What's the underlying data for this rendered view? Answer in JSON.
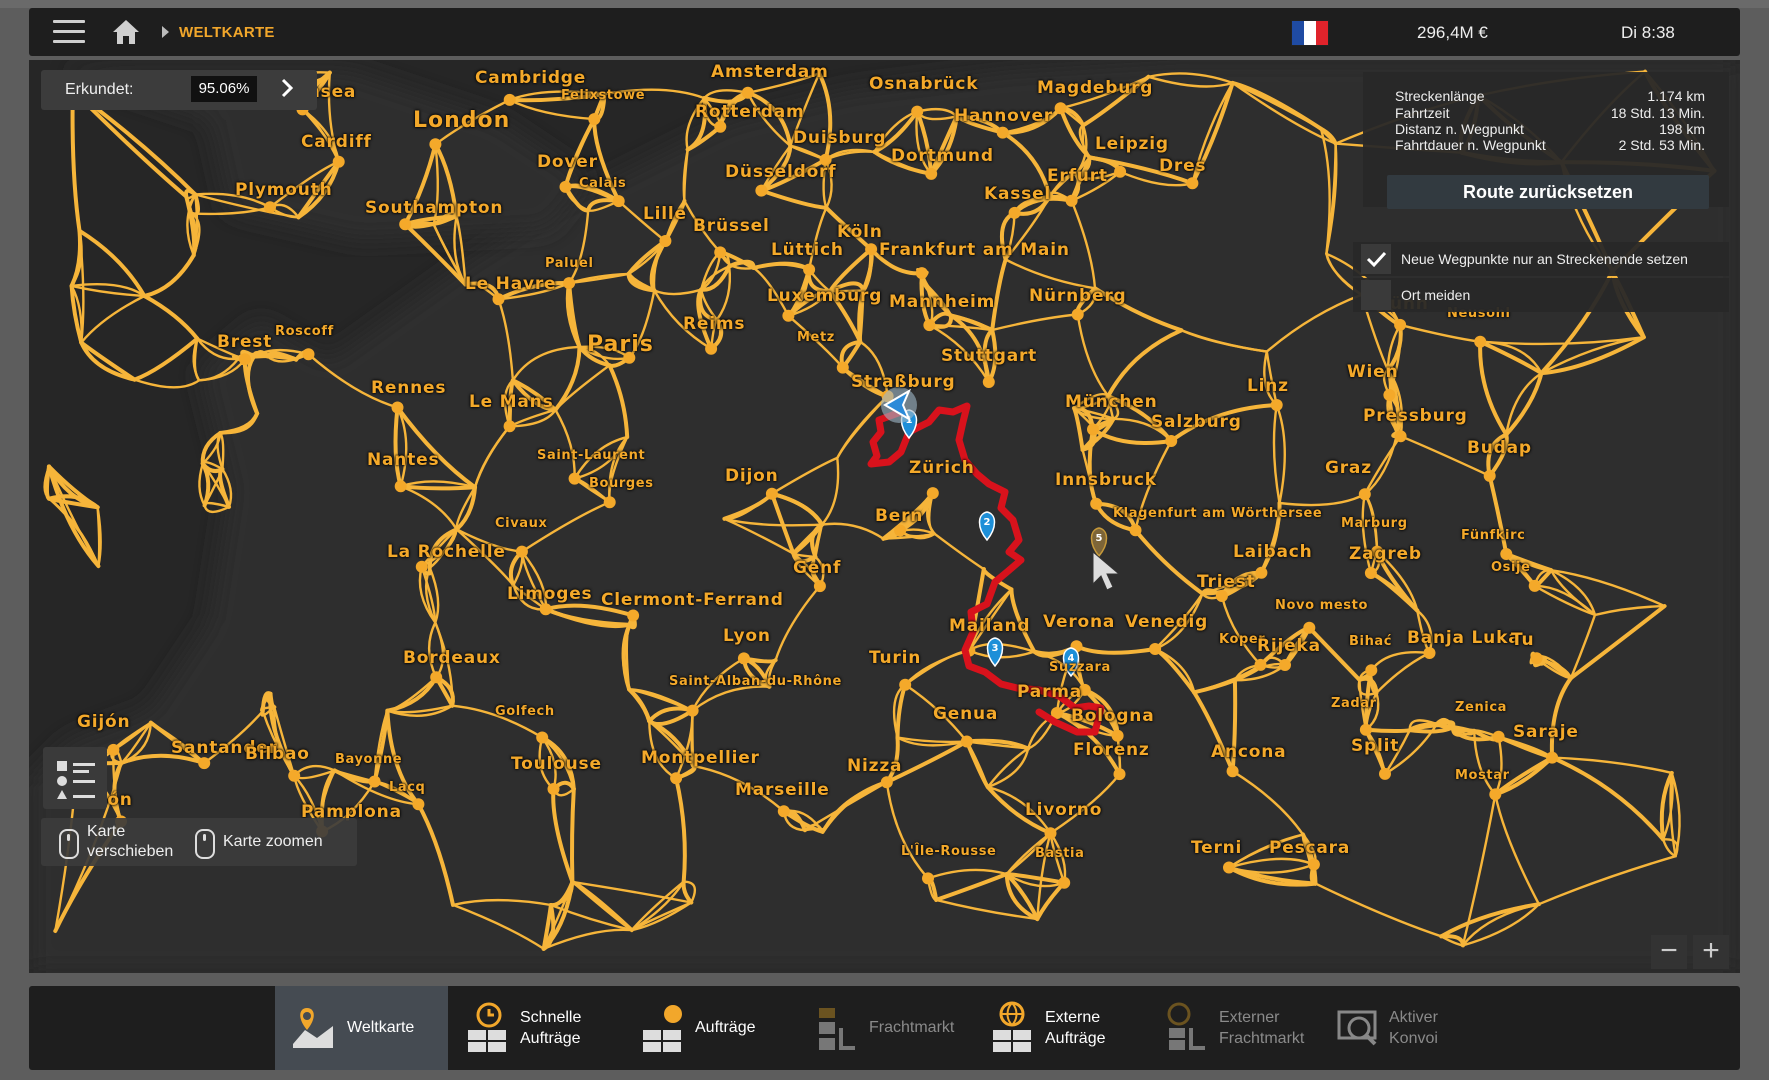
{
  "topbar": {
    "breadcrumb": "WELTKARTE",
    "money": "296,4M €",
    "time": "Di 8:38",
    "flag_colors": [
      "#1f4ba3",
      "#ffffff",
      "#e0232b"
    ]
  },
  "explored": {
    "label": "Erkundet:",
    "value": "95.06%"
  },
  "route": {
    "rows": [
      {
        "key": "Streckenlänge",
        "value": "1.174 km"
      },
      {
        "key": "Fahrtzeit",
        "value": "18 Std. 13 Min."
      },
      {
        "key": "Distanz n. Wegpunkt",
        "value": "198 km"
      },
      {
        "key": "Fahrtdauer n. Wegpunkt",
        "value": "2 Std. 53 Min."
      }
    ],
    "reset_label": "Route zurücksetzen",
    "option1": "Neue Wegpunkte nur an Streckenende setzen",
    "option2": "Ort meiden"
  },
  "hints": {
    "pan": "Karte\nverschieben",
    "pan1": "Karte",
    "pan2": "verschieben",
    "zoom": "Karte zoomen"
  },
  "zoom": {
    "minus": "−",
    "plus": "+"
  },
  "waypoints": [
    "1",
    "2",
    "3",
    "4",
    "5"
  ],
  "cities": [
    {
      "n": "Cambridge",
      "s": "md"
    },
    {
      "n": "wansea",
      "s": "md"
    },
    {
      "n": "Felixstowe",
      "s": "sm"
    },
    {
      "n": "London",
      "s": "lg"
    },
    {
      "n": "Cardiff",
      "s": "md"
    },
    {
      "n": "Dover",
      "s": "md"
    },
    {
      "n": "Calais",
      "s": "sm"
    },
    {
      "n": "Plymouth",
      "s": "md"
    },
    {
      "n": "Southampton",
      "s": "md"
    },
    {
      "n": "Amsterdam",
      "s": "md"
    },
    {
      "n": "Rotterdam",
      "s": "md"
    },
    {
      "n": "Osnabrück",
      "s": "md"
    },
    {
      "n": "Magdeburg",
      "s": "md"
    },
    {
      "n": "Hannover",
      "s": "md"
    },
    {
      "n": "Duisburg",
      "s": "md"
    },
    {
      "n": "Dortmund",
      "s": "md"
    },
    {
      "n": "Leipzig",
      "s": "md"
    },
    {
      "n": "Dres",
      "s": "md"
    },
    {
      "n": "Düsseldorf",
      "s": "md"
    },
    {
      "n": "Erfurt",
      "s": "md"
    },
    {
      "n": "Kassel",
      "s": "md"
    },
    {
      "n": "Lille",
      "s": "md"
    },
    {
      "n": "Brüssel",
      "s": "md"
    },
    {
      "n": "Köln",
      "s": "md"
    },
    {
      "n": "Lüttich",
      "s": "md"
    },
    {
      "n": "Frankfurt am Main",
      "s": "md"
    },
    {
      "n": "Paluel",
      "s": "sm"
    },
    {
      "n": "Le Havre",
      "s": "md"
    },
    {
      "n": "Luxemburg",
      "s": "md"
    },
    {
      "n": "Mannheim",
      "s": "md"
    },
    {
      "n": "Nürnberg",
      "s": "md"
    },
    {
      "n": "Brünn",
      "s": "md"
    },
    {
      "n": "Neusohl",
      "s": "sm"
    },
    {
      "n": "Roscoff",
      "s": "sm"
    },
    {
      "n": "Brest",
      "s": "md"
    },
    {
      "n": "Paris",
      "s": "lg"
    },
    {
      "n": "Reims",
      "s": "md"
    },
    {
      "n": "Metz",
      "s": "sm"
    },
    {
      "n": "Stuttgart",
      "s": "md"
    },
    {
      "n": "Wien",
      "s": "md"
    },
    {
      "n": "Straßburg",
      "s": "md"
    },
    {
      "n": "Linz",
      "s": "md"
    },
    {
      "n": "Rennes",
      "s": "md"
    },
    {
      "n": "Le Mans",
      "s": "md"
    },
    {
      "n": "München",
      "s": "md"
    },
    {
      "n": "Salzburg",
      "s": "md"
    },
    {
      "n": "Pressburg",
      "s": "md"
    },
    {
      "n": "Budap",
      "s": "md"
    },
    {
      "n": "Nantes",
      "s": "md"
    },
    {
      "n": "Saint-Laurent",
      "s": "sm"
    },
    {
      "n": "Zürich",
      "s": "md"
    },
    {
      "n": "Dijon",
      "s": "md"
    },
    {
      "n": "Bourges",
      "s": "sm"
    },
    {
      "n": "Innsbruck",
      "s": "md"
    },
    {
      "n": "Graz",
      "s": "md"
    },
    {
      "n": "Civaux",
      "s": "sm"
    },
    {
      "n": "Bern",
      "s": "md"
    },
    {
      "n": "Klagenfurt am Wörthersee",
      "s": "sm"
    },
    {
      "n": "Marburg",
      "s": "sm"
    },
    {
      "n": "Fünfkirc",
      "s": "sm"
    },
    {
      "n": "La Rochelle",
      "s": "md"
    },
    {
      "n": "Laibach",
      "s": "md"
    },
    {
      "n": "Zagreb",
      "s": "md"
    },
    {
      "n": "Genf",
      "s": "md"
    },
    {
      "n": "Osije",
      "s": "sm"
    },
    {
      "n": "Triest",
      "s": "md"
    },
    {
      "n": "Limoges",
      "s": "md"
    },
    {
      "n": "Clermont-Ferrand",
      "s": "md"
    },
    {
      "n": "Novo mesto",
      "s": "sm"
    },
    {
      "n": "Mailand",
      "s": "md"
    },
    {
      "n": "Verona",
      "s": "md"
    },
    {
      "n": "Venedig",
      "s": "md"
    },
    {
      "n": "Koper",
      "s": "sm"
    },
    {
      "n": "Rijeka",
      "s": "md"
    },
    {
      "n": "Bihać",
      "s": "sm"
    },
    {
      "n": "Banja Luka",
      "s": "md"
    },
    {
      "n": "Tu",
      "s": "md"
    },
    {
      "n": "Lyon",
      "s": "md"
    },
    {
      "n": "Bordeaux",
      "s": "md"
    },
    {
      "n": "Turin",
      "s": "md"
    },
    {
      "n": "Suzzara",
      "s": "sm"
    },
    {
      "n": "Saint-Alban-du-Rhône",
      "s": "sm"
    },
    {
      "n": "Parma",
      "s": "md"
    },
    {
      "n": "Golfech",
      "s": "sm"
    },
    {
      "n": "Genua",
      "s": "md"
    },
    {
      "n": "Bologna",
      "s": "md"
    },
    {
      "n": "Zadar",
      "s": "sm"
    },
    {
      "n": "Zenica",
      "s": "sm"
    },
    {
      "n": "Gijón",
      "s": "md"
    },
    {
      "n": "Saraje",
      "s": "md"
    },
    {
      "n": "Santander",
      "s": "md"
    },
    {
      "n": "Bilbao",
      "s": "md"
    },
    {
      "n": "Bayonne",
      "s": "sm"
    },
    {
      "n": "Toulouse",
      "s": "md"
    },
    {
      "n": "Montpellier",
      "s": "md"
    },
    {
      "n": "Florenz",
      "s": "md"
    },
    {
      "n": "Ancona",
      "s": "md"
    },
    {
      "n": "Split",
      "s": "md"
    },
    {
      "n": "Nizza",
      "s": "md"
    },
    {
      "n": "Mostar",
      "s": "sm"
    },
    {
      "n": "eón",
      "s": "md"
    },
    {
      "n": "Lacq",
      "s": "sm"
    },
    {
      "n": "Marseille",
      "s": "md"
    },
    {
      "n": "Pamplona",
      "s": "md"
    },
    {
      "n": "Livorno",
      "s": "md"
    },
    {
      "n": "L'Île-Rousse",
      "s": "sm"
    },
    {
      "n": "Bastia",
      "s": "sm"
    },
    {
      "n": "Terni",
      "s": "md"
    },
    {
      "n": "Pescara",
      "s": "md"
    }
  ],
  "tabs": [
    {
      "l1": "Weltkarte",
      "l2": ""
    },
    {
      "l1": "Schnelle",
      "l2": "Aufträge"
    },
    {
      "l1": "Aufträge",
      "l2": ""
    },
    {
      "l1": "Frachtmarkt",
      "l2": ""
    },
    {
      "l1": "Externe",
      "l2": "Aufträge"
    },
    {
      "l1": "Externer",
      "l2": "Frachtmarkt"
    },
    {
      "l1": "Aktiver",
      "l2": "Konvoi"
    }
  ],
  "colors": {
    "accent": "#f2a72b",
    "road": "#f6b53a",
    "route": "#d8121c",
    "waypoint": "#1d8fd8"
  }
}
